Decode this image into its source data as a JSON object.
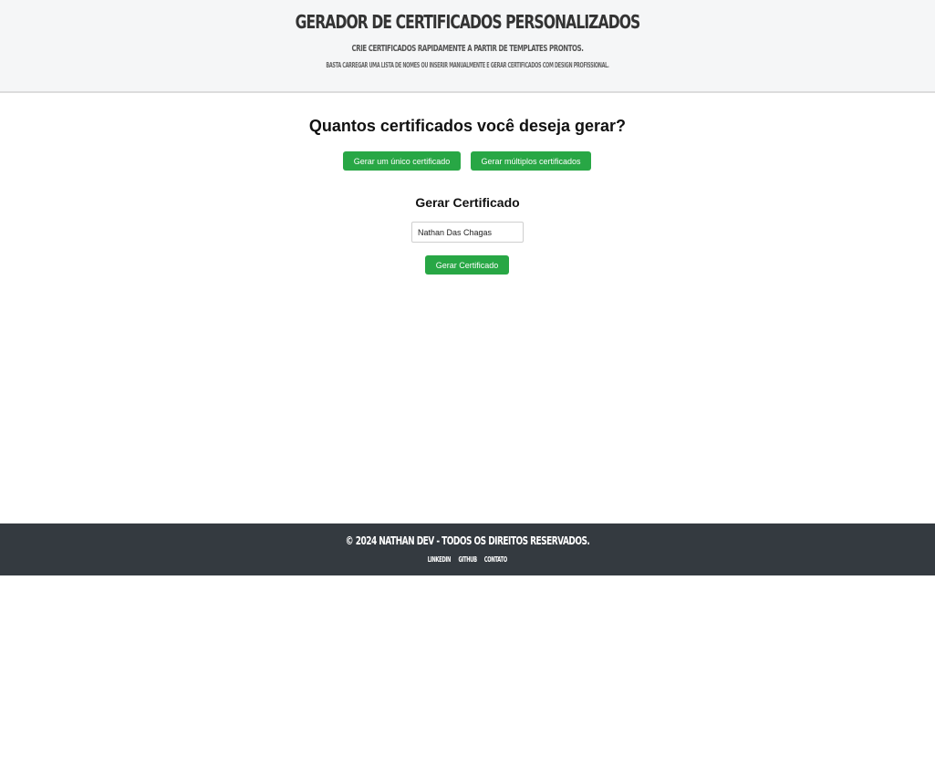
{
  "header": {
    "title": "Gerador de Certificados Personalizados",
    "subtitle": "Crie certificados rapidamente a partir de templates prontos.",
    "description": "Basta carregar uma lista de nomes ou inserir manualmente e gerar certificados com design profissional."
  },
  "main": {
    "question": "Quantos certificados você deseja gerar?",
    "single_button": "Gerar um único certificado",
    "multiple_button": "Gerar múltiplos certificados",
    "form_title": "Gerar Certificado",
    "name_value": "Nathan Das Chagas",
    "generate_button": "Gerar Certificado"
  },
  "footer": {
    "copyright": "© 2024 Nathan Dev - Todos os direitos reservados.",
    "links": [
      "LinkedIn",
      "GitHub",
      "Contato"
    ]
  },
  "colors": {
    "accent": "#28a745",
    "header_bg": "#f5f6f7",
    "footer_bg": "#343a40"
  }
}
